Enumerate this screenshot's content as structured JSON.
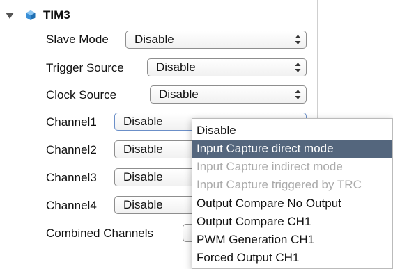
{
  "tree": {
    "title": "TIM3",
    "icon": "cube-icon"
  },
  "fields": {
    "slave_mode": {
      "label": "Slave Mode",
      "value": "Disable"
    },
    "trigger_source": {
      "label": "Trigger Source",
      "value": "Disable"
    },
    "clock_source": {
      "label": "Clock Source",
      "value": "Disable"
    },
    "channel1": {
      "label": "Channel1",
      "value": "Disable"
    },
    "channel2": {
      "label": "Channel2",
      "value": "Disable"
    },
    "channel3": {
      "label": "Channel3",
      "value": "Disable"
    },
    "channel4": {
      "label": "Channel4",
      "value": "Disable"
    },
    "combined_channels": {
      "label": "Combined Channels"
    }
  },
  "dropdown": {
    "options": [
      {
        "label": "Disable",
        "state": "normal"
      },
      {
        "label": "Input Capture direct mode",
        "state": "highlighted"
      },
      {
        "label": "Input Capture indirect mode",
        "state": "disabled"
      },
      {
        "label": "Input Capture triggered by TRC",
        "state": "disabled"
      },
      {
        "label": "Output Compare No Output",
        "state": "normal"
      },
      {
        "label": "Output Compare CH1",
        "state": "normal"
      },
      {
        "label": "PWM Generation CH1",
        "state": "normal"
      },
      {
        "label": "Forced Output CH1",
        "state": "normal"
      }
    ]
  },
  "colors": {
    "highlight": "#54667d",
    "disabled_text": "#aaaaaa",
    "icon_blue": "#3a8fd6"
  }
}
